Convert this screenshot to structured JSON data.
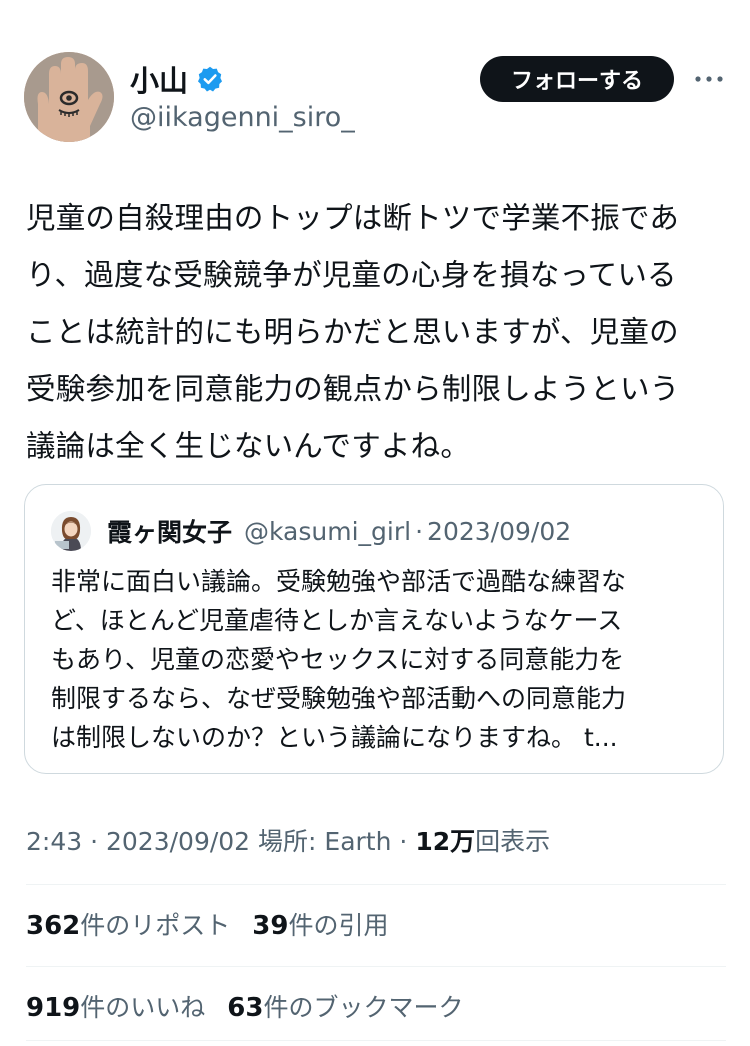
{
  "author": {
    "display_name": "小山",
    "handle": "@iikagenni_siro_",
    "avatar_icon": "hand-eye-avatar",
    "verified_icon": "verified-badge-icon",
    "verified_color": "#1d9bf0"
  },
  "actions": {
    "follow_label": "フォローする",
    "more_icon": "more-icon"
  },
  "tweet": {
    "lines": [
      "児童の自殺理由のトップは断トツで学業不振であ",
      "り、過度な受験競争が児童の心身を損なっている",
      "ことは統計的にも明らかだと思いますが、児童の",
      "受験参加を同意能力の観点から制限しようという",
      "議論は全く生じないんですよね。"
    ]
  },
  "quote": {
    "display_name": "霞ヶ関女子",
    "handle": "@kasumi_girl",
    "separator": "·",
    "date": "2023/09/02",
    "avatar_icon": "girl-avatar",
    "lines": [
      "非常に面白い議論。受験勉強や部活で過酷な練習な",
      "ど、ほとんど児童虐待としか言えないようなケース",
      "もあり、児童の恋愛やセックスに対する同意能力を",
      "制限するなら、なぜ受験勉強や部活動への同意能力",
      "は制限しないのか？という議論になりますね。 t..."
    ]
  },
  "meta": {
    "time": "2:43",
    "separator": "·",
    "date": "2023/09/02",
    "location": "場所: Earth",
    "views_num": "12万",
    "views_label": "回表示"
  },
  "stats": {
    "reposts_num": "362",
    "reposts_label": "件のリポスト",
    "quotes_num": "39",
    "quotes_label": "件の引用",
    "likes_num": "919",
    "likes_label": "件のいいね",
    "bookmarks_num": "63",
    "bookmarks_label": "件のブックマーク"
  },
  "colors": {
    "text_primary": "#0f1419",
    "text_secondary": "#536471",
    "border": "#cfd9de",
    "follow_button_bg": "#0f1419"
  }
}
